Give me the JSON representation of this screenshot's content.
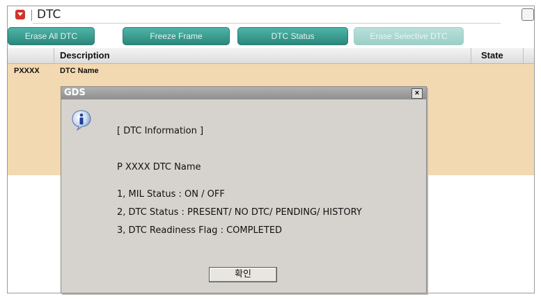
{
  "window": {
    "title": "DTC"
  },
  "toolbar": {
    "buttons": [
      {
        "label": "Erase All DTC",
        "enabled": true
      },
      {
        "label": "Freeze Frame",
        "enabled": true
      },
      {
        "label": "DTC Status",
        "enabled": true
      },
      {
        "label": "Erase Selective DTC",
        "enabled": false
      }
    ]
  },
  "table": {
    "headers": {
      "code": "",
      "description": "Description",
      "state": "State"
    },
    "rows": [
      {
        "code": "PXXXX",
        "description": "DTC Name",
        "state": ""
      }
    ]
  },
  "dialog": {
    "title": "GDS",
    "close_glyph": "×",
    "heading": "[ DTC Information ]",
    "dtc_line": "P XXXX  DTC Name",
    "lines": [
      "1, MIL Status : ON / OFF",
      "2, DTC Status : PRESENT/ NO DTC/ PENDING/ HISTORY",
      "3, DTC Readiness Flag : COMPLETED"
    ],
    "ok_label": "확인"
  },
  "colors": {
    "accent_teal": "#2f8f83",
    "table_row_bg": "#f3d9b1",
    "dialog_bg": "#d6d3ce"
  }
}
